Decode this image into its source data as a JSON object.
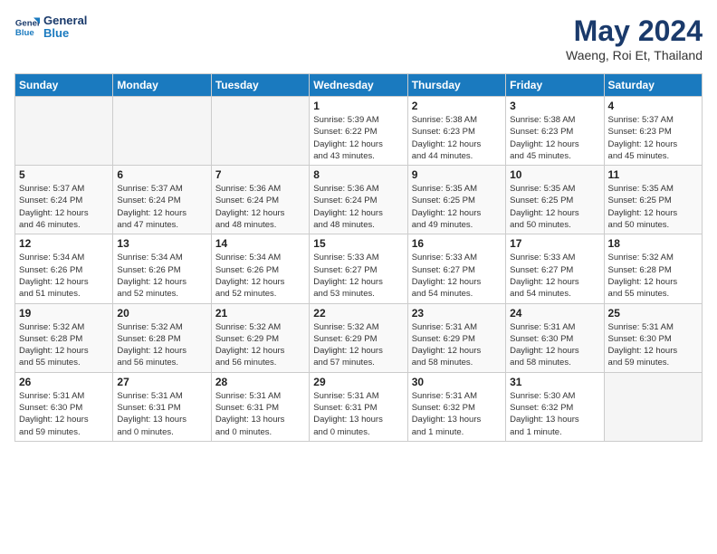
{
  "header": {
    "logo_line1": "General",
    "logo_line2": "Blue",
    "month": "May 2024",
    "location": "Waeng, Roi Et, Thailand"
  },
  "days_of_week": [
    "Sunday",
    "Monday",
    "Tuesday",
    "Wednesday",
    "Thursday",
    "Friday",
    "Saturday"
  ],
  "weeks": [
    [
      {
        "day": "",
        "info": ""
      },
      {
        "day": "",
        "info": ""
      },
      {
        "day": "",
        "info": ""
      },
      {
        "day": "1",
        "info": "Sunrise: 5:39 AM\nSunset: 6:22 PM\nDaylight: 12 hours\nand 43 minutes."
      },
      {
        "day": "2",
        "info": "Sunrise: 5:38 AM\nSunset: 6:23 PM\nDaylight: 12 hours\nand 44 minutes."
      },
      {
        "day": "3",
        "info": "Sunrise: 5:38 AM\nSunset: 6:23 PM\nDaylight: 12 hours\nand 45 minutes."
      },
      {
        "day": "4",
        "info": "Sunrise: 5:37 AM\nSunset: 6:23 PM\nDaylight: 12 hours\nand 45 minutes."
      }
    ],
    [
      {
        "day": "5",
        "info": "Sunrise: 5:37 AM\nSunset: 6:24 PM\nDaylight: 12 hours\nand 46 minutes."
      },
      {
        "day": "6",
        "info": "Sunrise: 5:37 AM\nSunset: 6:24 PM\nDaylight: 12 hours\nand 47 minutes."
      },
      {
        "day": "7",
        "info": "Sunrise: 5:36 AM\nSunset: 6:24 PM\nDaylight: 12 hours\nand 48 minutes."
      },
      {
        "day": "8",
        "info": "Sunrise: 5:36 AM\nSunset: 6:24 PM\nDaylight: 12 hours\nand 48 minutes."
      },
      {
        "day": "9",
        "info": "Sunrise: 5:35 AM\nSunset: 6:25 PM\nDaylight: 12 hours\nand 49 minutes."
      },
      {
        "day": "10",
        "info": "Sunrise: 5:35 AM\nSunset: 6:25 PM\nDaylight: 12 hours\nand 50 minutes."
      },
      {
        "day": "11",
        "info": "Sunrise: 5:35 AM\nSunset: 6:25 PM\nDaylight: 12 hours\nand 50 minutes."
      }
    ],
    [
      {
        "day": "12",
        "info": "Sunrise: 5:34 AM\nSunset: 6:26 PM\nDaylight: 12 hours\nand 51 minutes."
      },
      {
        "day": "13",
        "info": "Sunrise: 5:34 AM\nSunset: 6:26 PM\nDaylight: 12 hours\nand 52 minutes."
      },
      {
        "day": "14",
        "info": "Sunrise: 5:34 AM\nSunset: 6:26 PM\nDaylight: 12 hours\nand 52 minutes."
      },
      {
        "day": "15",
        "info": "Sunrise: 5:33 AM\nSunset: 6:27 PM\nDaylight: 12 hours\nand 53 minutes."
      },
      {
        "day": "16",
        "info": "Sunrise: 5:33 AM\nSunset: 6:27 PM\nDaylight: 12 hours\nand 54 minutes."
      },
      {
        "day": "17",
        "info": "Sunrise: 5:33 AM\nSunset: 6:27 PM\nDaylight: 12 hours\nand 54 minutes."
      },
      {
        "day": "18",
        "info": "Sunrise: 5:32 AM\nSunset: 6:28 PM\nDaylight: 12 hours\nand 55 minutes."
      }
    ],
    [
      {
        "day": "19",
        "info": "Sunrise: 5:32 AM\nSunset: 6:28 PM\nDaylight: 12 hours\nand 55 minutes."
      },
      {
        "day": "20",
        "info": "Sunrise: 5:32 AM\nSunset: 6:28 PM\nDaylight: 12 hours\nand 56 minutes."
      },
      {
        "day": "21",
        "info": "Sunrise: 5:32 AM\nSunset: 6:29 PM\nDaylight: 12 hours\nand 56 minutes."
      },
      {
        "day": "22",
        "info": "Sunrise: 5:32 AM\nSunset: 6:29 PM\nDaylight: 12 hours\nand 57 minutes."
      },
      {
        "day": "23",
        "info": "Sunrise: 5:31 AM\nSunset: 6:29 PM\nDaylight: 12 hours\nand 58 minutes."
      },
      {
        "day": "24",
        "info": "Sunrise: 5:31 AM\nSunset: 6:30 PM\nDaylight: 12 hours\nand 58 minutes."
      },
      {
        "day": "25",
        "info": "Sunrise: 5:31 AM\nSunset: 6:30 PM\nDaylight: 12 hours\nand 59 minutes."
      }
    ],
    [
      {
        "day": "26",
        "info": "Sunrise: 5:31 AM\nSunset: 6:30 PM\nDaylight: 12 hours\nand 59 minutes."
      },
      {
        "day": "27",
        "info": "Sunrise: 5:31 AM\nSunset: 6:31 PM\nDaylight: 13 hours\nand 0 minutes."
      },
      {
        "day": "28",
        "info": "Sunrise: 5:31 AM\nSunset: 6:31 PM\nDaylight: 13 hours\nand 0 minutes."
      },
      {
        "day": "29",
        "info": "Sunrise: 5:31 AM\nSunset: 6:31 PM\nDaylight: 13 hours\nand 0 minutes."
      },
      {
        "day": "30",
        "info": "Sunrise: 5:31 AM\nSunset: 6:32 PM\nDaylight: 13 hours\nand 1 minute."
      },
      {
        "day": "31",
        "info": "Sunrise: 5:30 AM\nSunset: 6:32 PM\nDaylight: 13 hours\nand 1 minute."
      },
      {
        "day": "",
        "info": ""
      }
    ]
  ]
}
